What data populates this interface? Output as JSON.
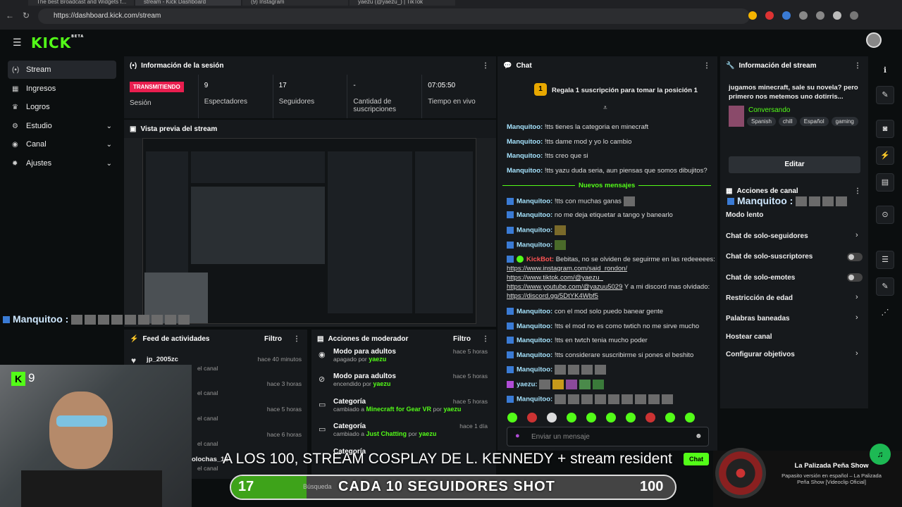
{
  "browser": {
    "tabs": [
      "The best Broadcast and Widgets f...",
      "stream - Kick Dashboard",
      "(9) Instagram",
      "yaezu (@yaezu_) | TikTok"
    ],
    "url": "https://dashboard.kick.com/stream"
  },
  "app": {
    "logo": "KICK",
    "logo_badge": "BETA"
  },
  "sidebar": {
    "items": [
      {
        "label": "Stream",
        "icon": "broadcast-icon"
      },
      {
        "label": "Ingresos",
        "icon": "chart-icon"
      },
      {
        "label": "Logros",
        "icon": "trophy-icon"
      },
      {
        "label": "Estudio",
        "icon": "studio-icon"
      },
      {
        "label": "Canal",
        "icon": "user-icon"
      },
      {
        "label": "Ajustes",
        "icon": "gear-icon"
      }
    ]
  },
  "session": {
    "title": "Información de la sesión",
    "live_badge": "TRANSMITIENDO",
    "session_label": "Sesión",
    "viewers": "9",
    "viewers_label": "Espectadores",
    "followers": "17",
    "followers_label": "Seguidores",
    "subs": "-",
    "subs_label": "Cantidad de suscripciones",
    "uptime": "07:05:50",
    "uptime_label": "Tiempo en vivo"
  },
  "preview": {
    "title": "Vista previa del stream"
  },
  "chat": {
    "title": "Chat",
    "gift": "Regala 1 suscripción para tomar la posición 1",
    "gift_rank": "1",
    "new_messages": "Nuevos mensajes",
    "messages": [
      {
        "user": "Manquitoo:",
        "text": "!tts tienes la categoria en minecraft"
      },
      {
        "user": "Manquitoo:",
        "text": "!tts dame mod y yo lo cambio"
      },
      {
        "user": "Manquitoo:",
        "text": "!tts creo que si"
      },
      {
        "user": "Manquitoo:",
        "text": "!tts yazu duda seria, aun piensas que somos dibujitos?"
      },
      {
        "user": "Manquitoo:",
        "text": "!tts con muchas ganas"
      },
      {
        "user": "Manquitoo:",
        "text": "no me deja etiquetar a tango y banearlo"
      },
      {
        "user": "Manquitoo:",
        "text": ""
      },
      {
        "user": "Manquitoo:",
        "text": ""
      },
      {
        "user": "Manquitoo:",
        "text": "con el mod solo puedo banear gente"
      },
      {
        "user": "Manquitoo:",
        "text": "!tts el mod no es como twtich no me sirve mucho"
      },
      {
        "user": "Manquitoo:",
        "text": "!tts en twtch tenia mucho poder"
      },
      {
        "user": "Manquitoo:",
        "text": "!tts considerare suscribirme si pones el beshito"
      },
      {
        "user": "Manquitoo:",
        "text": ""
      },
      {
        "user": "yaezu:",
        "text": ""
      },
      {
        "user": "Manquitoo:",
        "text": ""
      }
    ],
    "kickbot": {
      "user": "KickBot:",
      "text": "Bebitas, no se olviden de seguirme en las redeeeees:",
      "links": [
        "https://www.instagram.com/said_rondon/",
        "https://www.tiktok.com/@yaezu_",
        "https://www.youtube.com/@yazuu5029",
        "https://discord.gg/5DtYK4Wbf5"
      ],
      "tail": "Y a mi discord mas olvidado:"
    },
    "input_placeholder": "Enviar un mensaje",
    "send_label": "Chat"
  },
  "stream_info": {
    "title": "Información del stream",
    "description": "jugamos minecraft, sale su novela? pero primero nos metemos uno dotirris...",
    "category": "Conversando",
    "tags": [
      "Spanish",
      "chill",
      "Español",
      "gaming"
    ],
    "edit_label": "Editar"
  },
  "channel_actions": {
    "title": "Acciones de canal",
    "items": [
      {
        "label": "Modo lento"
      },
      {
        "label": "Chat de solo-seguidores"
      },
      {
        "label": "Chat de solo-suscriptores"
      },
      {
        "label": "Chat de solo-emotes"
      },
      {
        "label": "Restricción de edad"
      },
      {
        "label": "Palabras baneadas"
      },
      {
        "label": "Hostear canal"
      },
      {
        "label": "Configurar objetivos"
      }
    ]
  },
  "feed": {
    "title": "Feed de actividades",
    "filter": "Filtro",
    "rows": [
      {
        "user": "jp_2005zc",
        "sub": "el canal",
        "time": "hace 40 minutos"
      },
      {
        "user": "",
        "sub": "el canal",
        "time": "hace 3 horas"
      },
      {
        "user": "",
        "sub": "el canal",
        "time": "hace 5 horas"
      },
      {
        "user": "",
        "sub": "el canal",
        "time": "hace 6 horas"
      },
      {
        "user": "olochas_12",
        "sub": "el canal",
        "time": ""
      }
    ]
  },
  "mod_actions": {
    "title": "Acciones de moderador",
    "filter": "Filtro",
    "rows": [
      {
        "title": "Modo para adultos",
        "pre": "apagado por",
        "by": "yaezu",
        "time": "hace 5 horas"
      },
      {
        "title": "Modo para adultos",
        "pre": "encendido por",
        "by": "yaezu",
        "time": "hace 5 horas"
      },
      {
        "title": "Categoría",
        "pre": "cambiado a",
        "value": "Minecraft for Gear VR",
        "mid": "por",
        "by": "yaezu",
        "time": "hace 5 horas"
      },
      {
        "title": "Categoría",
        "pre": "cambiado a",
        "value": "Just Chatting",
        "mid": "por",
        "by": "yaezu",
        "time": "hace 1 día"
      },
      {
        "title": "Categoría",
        "pre": "",
        "by": "",
        "time": ""
      }
    ]
  },
  "overlay": {
    "chat_user": "Manquitoo :",
    "cam_viewers": "9",
    "ticker": "A LOS 100, STREAM COSPLAY DE L. KENNEDY + stream resident",
    "goal_current": "17",
    "goal_label": "CADA 10 SEGUIDORES SHOT",
    "goal_target": "100",
    "goal_progress": 0.17,
    "search_hint": "Búsqueda",
    "now_playing_title": "La Palizada Peña Show",
    "now_playing_sub": "Papasito versión en español – La Palizada Peña Show [Videoclip Oficial]"
  },
  "colors": {
    "accent": "#53fc18",
    "live": "#e91e4f",
    "username": "#a6e4ff",
    "bot": "#ff5454"
  }
}
